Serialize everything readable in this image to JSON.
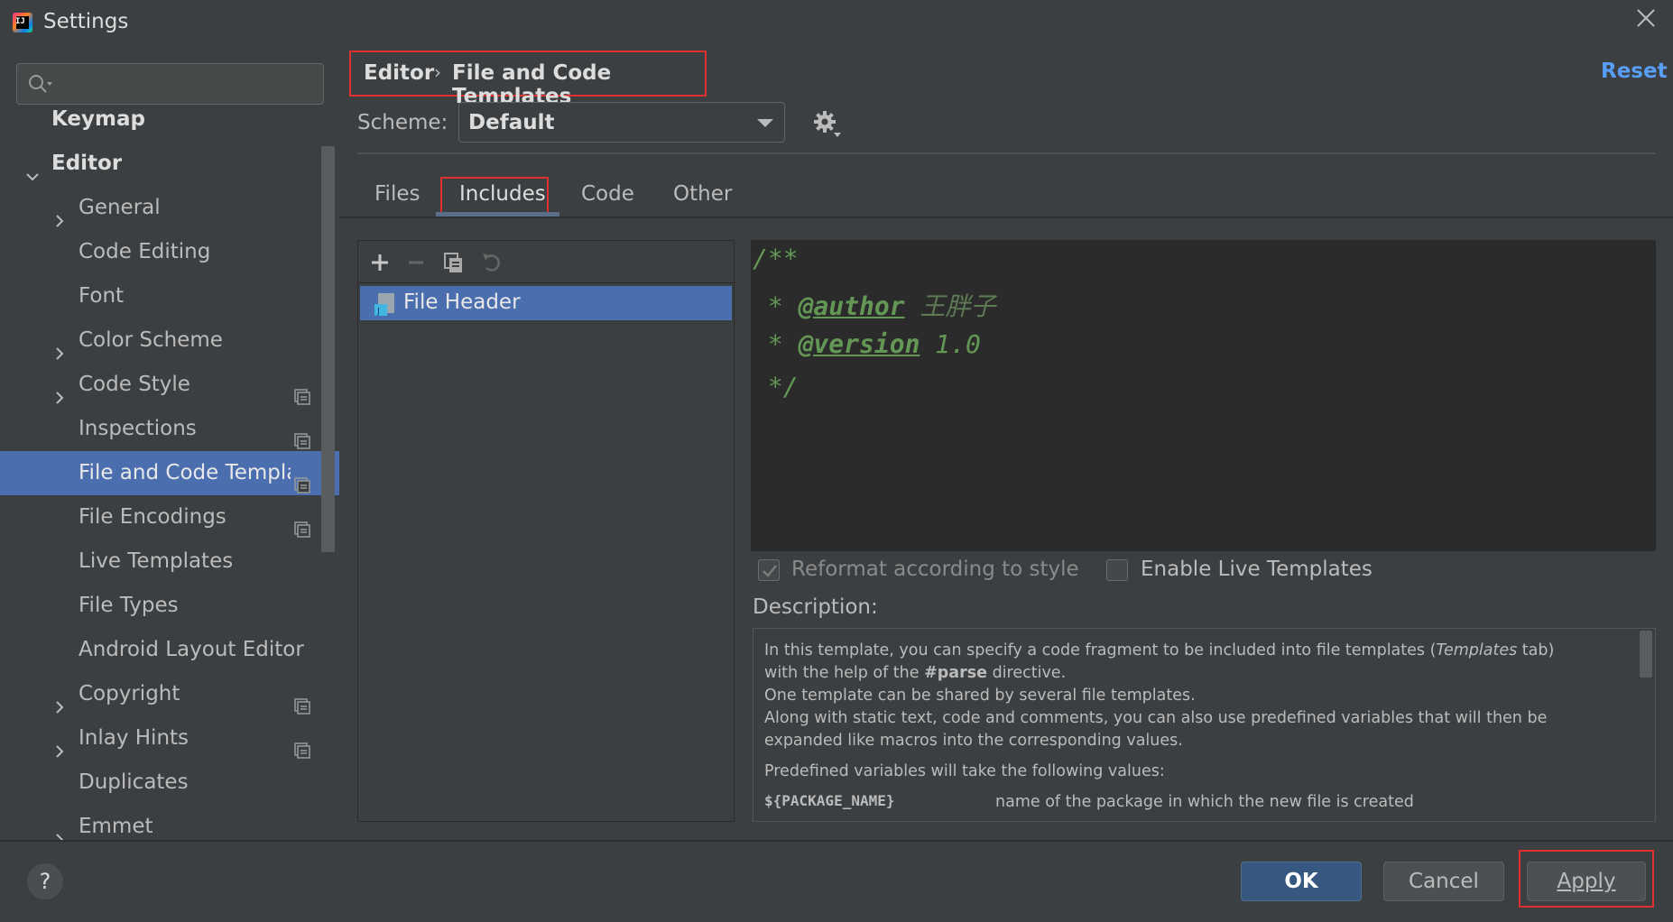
{
  "window": {
    "title": "Settings",
    "app_icon_text": "IJ"
  },
  "search": {
    "placeholder": ""
  },
  "sidebar": {
    "items": [
      {
        "label": "Keymap",
        "level": 0,
        "expandable": false,
        "bold": true
      },
      {
        "label": "Editor",
        "level": 0,
        "expandable": true,
        "expanded": true,
        "bold": true
      },
      {
        "label": "General",
        "level": 1,
        "expandable": true
      },
      {
        "label": "Code Editing",
        "level": 1,
        "expandable": false
      },
      {
        "label": "Font",
        "level": 1,
        "expandable": false
      },
      {
        "label": "Color Scheme",
        "level": 1,
        "expandable": true
      },
      {
        "label": "Code Style",
        "level": 1,
        "expandable": true,
        "project_icon": true
      },
      {
        "label": "Inspections",
        "level": 1,
        "expandable": false,
        "project_icon": true
      },
      {
        "label": "File and Code Templates",
        "level": 1,
        "expandable": false,
        "project_icon": true,
        "selected": true
      },
      {
        "label": "File Encodings",
        "level": 1,
        "expandable": false,
        "project_icon": true
      },
      {
        "label": "Live Templates",
        "level": 1,
        "expandable": false
      },
      {
        "label": "File Types",
        "level": 1,
        "expandable": false
      },
      {
        "label": "Android Layout Editor",
        "level": 1,
        "expandable": false
      },
      {
        "label": "Copyright",
        "level": 1,
        "expandable": true,
        "project_icon": true
      },
      {
        "label": "Inlay Hints",
        "level": 1,
        "expandable": true,
        "project_icon": true
      },
      {
        "label": "Duplicates",
        "level": 1,
        "expandable": false
      },
      {
        "label": "Emmet",
        "level": 1,
        "expandable": true
      }
    ]
  },
  "breadcrumb": {
    "parent": "Editor",
    "separator": "›",
    "current": "File and Code Templates"
  },
  "reset_label": "Reset",
  "scheme": {
    "label": "Scheme:",
    "value": "Default"
  },
  "tabs": [
    {
      "label": "Files",
      "active": false
    },
    {
      "label": "Includes",
      "active": true
    },
    {
      "label": "Code",
      "active": false
    },
    {
      "label": "Other",
      "active": false
    }
  ],
  "template_list": {
    "items": [
      {
        "label": "File Header",
        "selected": true
      }
    ]
  },
  "editor": {
    "lines": [
      {
        "prefix": "/**",
        "tag": "",
        "value": ""
      },
      {
        "prefix": " * ",
        "tag": "@author",
        "value": " 王胖子"
      },
      {
        "prefix": " * ",
        "tag": "@version",
        "value": " 1.0"
      },
      {
        "prefix": " */",
        "tag": "",
        "value": ""
      }
    ]
  },
  "options": {
    "reformat": {
      "label": "Reformat according to style",
      "checked": true,
      "enabled": false
    },
    "live_templates": {
      "label": "Enable Live Templates",
      "checked": false,
      "enabled": true
    }
  },
  "description": {
    "label": "Description:",
    "line1a": "In this template, you can specify a code fragment to be included into file templates (",
    "line1b": "Templates",
    "line1c": " tab)",
    "line2a": "with the help of the ",
    "line2b": "#parse",
    "line2c": " directive.",
    "line3": "One template can be shared by several file templates.",
    "line4": "Along with static text, code and comments, you can also use predefined variables that will then be",
    "line5": "expanded like macros into the corresponding values.",
    "line6": "Predefined variables will take the following values:",
    "var_name": "${PACKAGE_NAME}",
    "var_desc": "name of the package in which the new file is created"
  },
  "footer": {
    "help": "?",
    "ok": "OK",
    "cancel": "Cancel",
    "apply": "Apply"
  },
  "colors": {
    "selection": "#4b6eaf",
    "accent_link": "#589df6",
    "highlight_box": "#e03131",
    "doc_comment": "#629755"
  }
}
